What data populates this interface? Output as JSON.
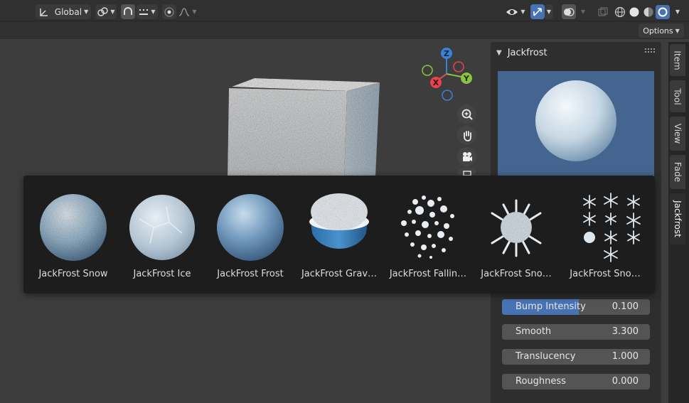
{
  "header": {
    "transform_orientation": "Global",
    "options_label": "Options"
  },
  "icons": {
    "orientation": "transform-orientation-icon",
    "pivot": "pivot-point-icon",
    "snap": "snap-icon",
    "increment": "snap-increment-icon",
    "proportional": "proportional-editing-icon",
    "falloff": "falloff-curve-icon",
    "visibility": "eye-icon",
    "gizmo": "gizmo-icon",
    "overlays": "overlays-icon",
    "xray": "xray-icon",
    "shading": [
      "wireframe-shading-icon",
      "solid-shading-icon",
      "material-preview-icon",
      "rendered-shading-icon"
    ]
  },
  "gizmo": {
    "x": "X",
    "y": "Y",
    "z": "Z"
  },
  "panel": {
    "title": "Jackfrost",
    "tabs": [
      "Item",
      "Tool",
      "View",
      "Fade",
      "Jackfrost"
    ],
    "active_tab": "Jackfrost",
    "sliders": [
      {
        "label": "Bump Intensity",
        "value": "0.100",
        "fill_fraction": 0.52
      },
      {
        "label": "Smooth",
        "value": "3.300",
        "fill_fraction": 0
      },
      {
        "label": "Translucency",
        "value": "1.000",
        "fill_fraction": 0
      },
      {
        "label": "Roughness",
        "value": "0.000",
        "fill_fraction": 0
      }
    ]
  },
  "assets": [
    {
      "name": "JackFrost Snow"
    },
    {
      "name": "JackFrost Ice"
    },
    {
      "name": "JackFrost Frost"
    },
    {
      "name": "JackFrost Grav…"
    },
    {
      "name": "JackFrost Fallin…"
    },
    {
      "name": "JackFrost Sno…"
    },
    {
      "name": "JackFrost Sno…"
    }
  ],
  "colors": {
    "viewport_bg": "#3d3d3d",
    "accent": "#4772b3",
    "preview_bg": "#44658f",
    "axis_x": "#e5444f",
    "axis_y": "#8bc43e",
    "axis_z": "#3b82d6"
  }
}
